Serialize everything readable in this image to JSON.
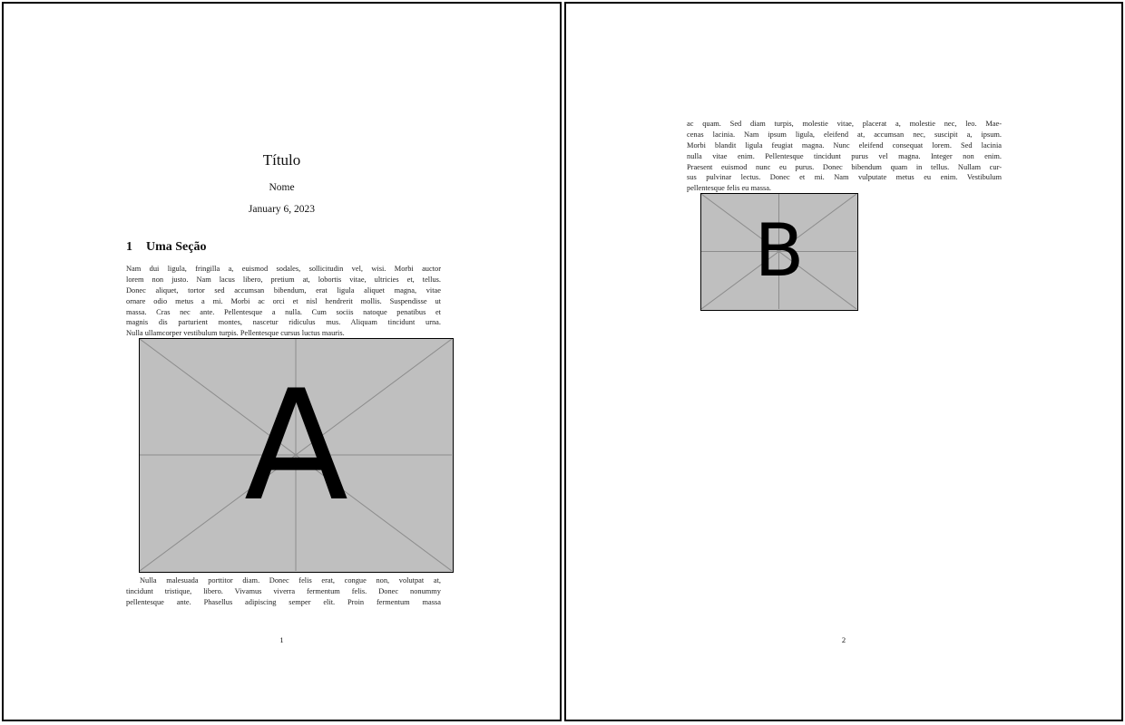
{
  "page1": {
    "title": "Título",
    "author": "Nome",
    "date": "January 6, 2023",
    "section": {
      "number": "1",
      "title": "Uma Seção"
    },
    "paragraph1_lines": [
      "Nam dui ligula, fringilla a, euismod sodales, sollicitudin vel, wisi. Morbi auctor",
      "lorem non justo. Nam lacus libero, pretium at, lobortis vitae, ultricies et, tellus.",
      "Donec aliquet, tortor sed accumsan bibendum, erat ligula aliquet magna, vitae",
      "ornare odio metus a mi. Morbi ac orci et nisl hendrerit mollis. Suspendisse ut",
      "massa. Cras nec ante. Pellentesque a nulla. Cum sociis natoque penatibus et",
      "magnis dis parturient montes, nascetur ridiculus mus. Aliquam tincidunt urna.",
      "Nulla ullamcorper vestibulum turpis. Pellentesque cursus luctus mauris."
    ],
    "figure_label": "A",
    "paragraph2_lines": [
      "Nulla malesuada porttitor diam. Donec felis erat, congue non, volutpat at,",
      "tincidunt tristique, libero. Vivamus viverra fermentum felis. Donec nonummy",
      "pellentesque ante. Phasellus adipiscing semper elit. Proin fermentum massa"
    ],
    "page_number": "1"
  },
  "page2": {
    "paragraph_lines": [
      "ac quam. Sed diam turpis, molestie vitae, placerat a, molestie nec, leo. Mae-",
      "cenas lacinia. Nam ipsum ligula, eleifend at, accumsan nec, suscipit a, ipsum.",
      "Morbi blandit ligula feugiat magna. Nunc eleifend consequat lorem. Sed lacinia",
      "nulla vitae enim. Pellentesque tincidunt purus vel magna. Integer non enim.",
      "Praesent euismod nunc eu purus. Donec bibendum quam in tellus. Nullam cur-",
      "sus pulvinar lectus. Donec et mi. Nam vulputate metus eu enim. Vestibulum",
      "pellentesque felis eu massa."
    ],
    "figure_label": "B",
    "page_number": "2"
  },
  "colors": {
    "page_background": "#ffffff",
    "page_border": "#000000",
    "figure_fill": "#bfbfbf",
    "figure_lines": "#8c8c8c"
  }
}
